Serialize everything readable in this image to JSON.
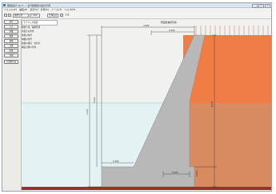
{
  "window": {
    "title": "擁壁設計 Ver.3  —  逆T型擁壁の設計計算"
  },
  "window_buttons": [
    "_",
    "□",
    "×"
  ],
  "menu": {
    "items": [
      "ファイル(F)",
      "編集(E)",
      "表示(V)",
      "計算(C)",
      "ツール(T)",
      "ヘルプ(H)"
    ]
  },
  "toolbar": {
    "field1": "擁壁形状",
    "field2": "1.000",
    "field3": "全体表示",
    "checkbox_label": "寸法"
  },
  "left_panel": {
    "buttons": [
      "形状",
      "土圧",
      "荷重",
      "地盤",
      "基礎",
      "計算",
      "結果",
      "印刷",
      "計算書作成"
    ]
  },
  "side_list": {
    "header": "モデル入力画面",
    "items": [
      "躯体寸法・擁壁形状",
      "背面土の条件",
      "荷重の条件",
      "地盤の条件",
      "基礎の検討・支持力",
      "構造計算の条件"
    ]
  },
  "canvas": {
    "title_label": "断面図(擁壁形状)",
    "dims": {
      "top_width": "0.500",
      "overall_top": "4.000",
      "right_height": "6.000",
      "left_height": "5.500",
      "toe_width": "1.000",
      "heel_width": "2.000",
      "base_height": "0.800",
      "left_total": "7.000"
    }
  },
  "colors": {
    "water": "#e3f2f3",
    "soil": "#f07c46",
    "soil_submerged": "#d78b5e",
    "wall": "#b8b8b8",
    "ground": "#9d3224",
    "dimension": "#222222"
  }
}
